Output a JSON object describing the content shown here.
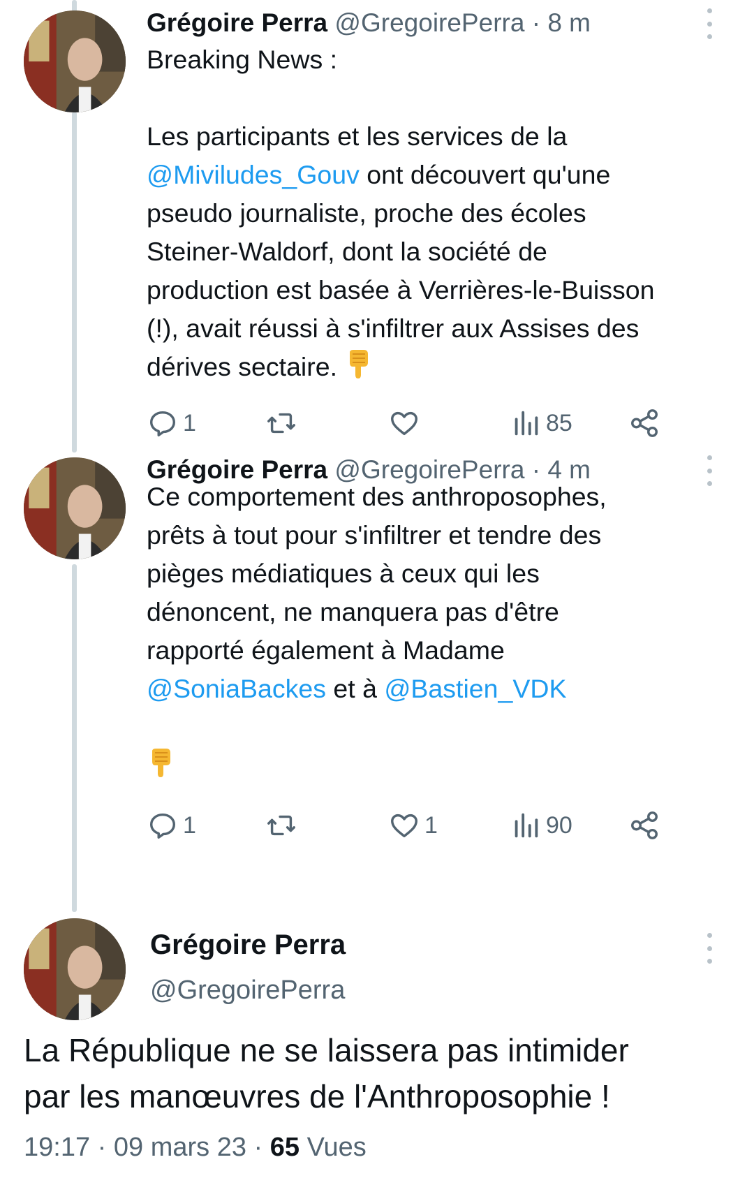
{
  "tweets": [
    {
      "name": "Grégoire Perra",
      "handle": "@GregoirePerra",
      "time": "8 m",
      "text_lines": [
        "Breaking News :"
      ],
      "text_parts": {
        "l1": "Les participants et les services de la",
        "m1": "@Miviludes_Gouv",
        "l2": " ont découvert qu'une",
        "l3": "pseudo journaliste, proche des écoles",
        "l4": "Steiner-Waldorf, dont la société de",
        "l5": "production est basée à Verrières-le-Buisson",
        "l6": "(!), avait réussi à s'infiltrer aux Assises des",
        "l7": "dérives sectaire. "
      },
      "emoji": "backhand-index-pointing-down",
      "actions": {
        "replies": "1",
        "retweets": "",
        "likes": "",
        "views": "85"
      }
    },
    {
      "name": "Grégoire Perra",
      "handle": "@GregoirePerra",
      "time": "4 m",
      "text_parts": {
        "l1": "Ce comportement des anthroposophes,",
        "l2": "prêts à tout pour s'infiltrer et tendre des",
        "l3": "pièges médiatiques à ceux qui les",
        "l4": "dénoncent, ne manquera pas d'être",
        "l5": "rapporté également à Madame",
        "m1": "@SoniaBackes",
        "l6": " et à ",
        "m2": "@Bastien_VDK"
      },
      "emoji": "backhand-index-pointing-down",
      "actions": {
        "replies": "1",
        "retweets": "",
        "likes": "1",
        "views": "90"
      }
    }
  ],
  "main_tweet": {
    "name": "Grégoire Perra",
    "handle": "@GregoirePerra",
    "line1": "La République ne se laissera pas intimider",
    "line2": "par les manœuvres de l'Anthroposophie !",
    "time": "19:17",
    "date": "09 mars 23",
    "views_count": "65",
    "views_label": "Vues"
  },
  "colors": {
    "mention": "#1d9bf0",
    "secondary": "#536471",
    "thread_line": "#cfd9de"
  },
  "icons": [
    "reply-icon",
    "retweet-icon",
    "like-icon",
    "views-icon",
    "share-icon",
    "more-options-icon"
  ]
}
